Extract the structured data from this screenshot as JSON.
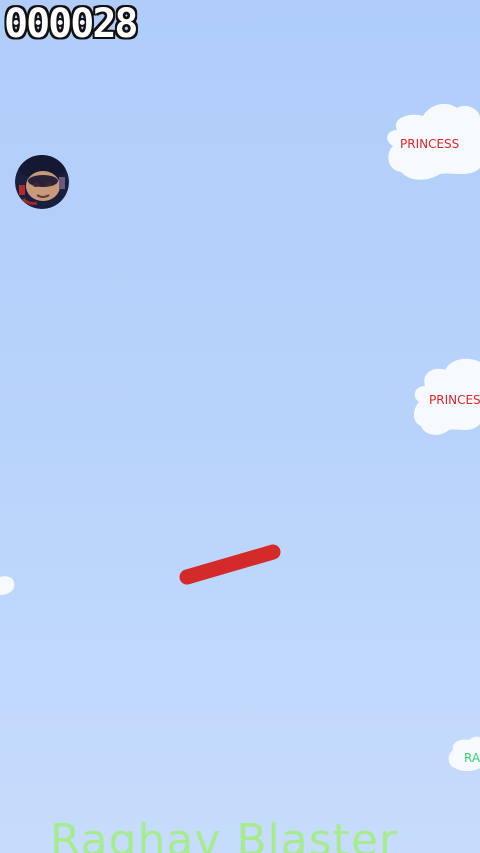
{
  "hud": {
    "score": "000028"
  },
  "clouds": [
    {
      "label": "PRINCESS",
      "label_color": "#e22424"
    },
    {
      "label": "PRINCES",
      "label_color": "#e22424"
    },
    {
      "label": "",
      "label_color": "#e22424"
    },
    {
      "label": "RA",
      "label_color": "#36d46a"
    }
  ],
  "player": {
    "avatar_icon": "player-face-avatar"
  },
  "platform": {
    "color": "#d42a2a"
  },
  "game": {
    "title": "Raghav Blaster",
    "title_color": "#a6ec8e"
  },
  "colors": {
    "sky_top": "#b0cdfa",
    "sky_bottom": "#c6dcfc",
    "cloud": "#f6faff"
  }
}
